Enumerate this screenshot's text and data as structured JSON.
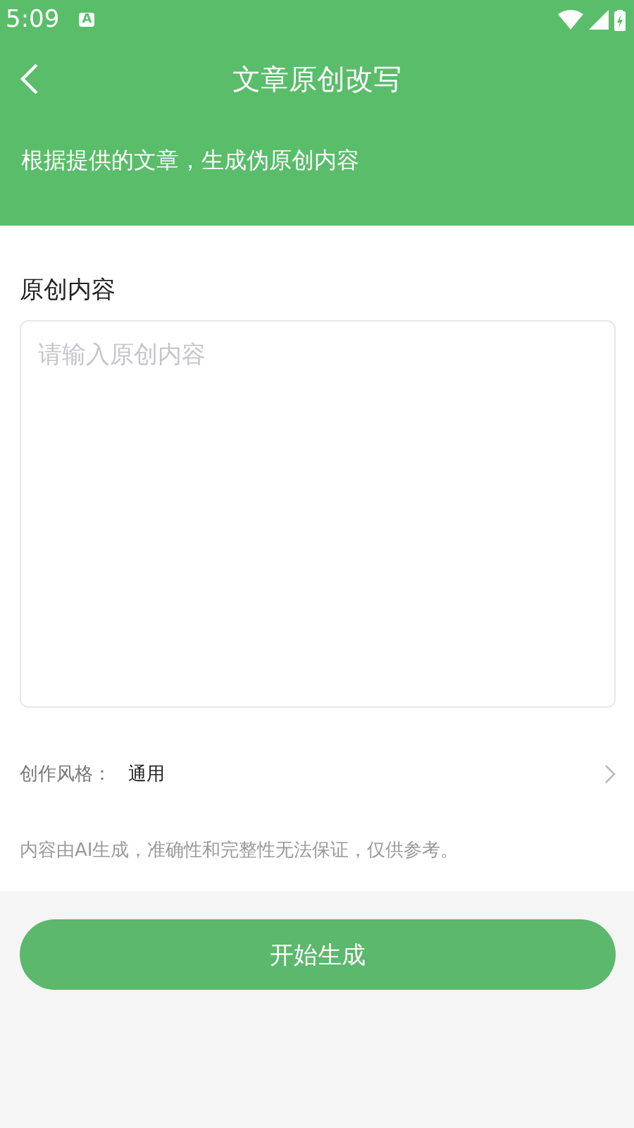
{
  "status_bar": {
    "time": "5:09",
    "notification": "A"
  },
  "header": {
    "title": "文章原创改写",
    "subtitle": "根据提供的文章，生成伪原创内容"
  },
  "form": {
    "label": "原创内容",
    "placeholder": "请输入原创内容"
  },
  "style_row": {
    "label": "创作风格：",
    "value": "通用"
  },
  "disclaimer": "内容由AI生成，准确性和完整性无法保证，仅供参考。",
  "button": "开始生成"
}
